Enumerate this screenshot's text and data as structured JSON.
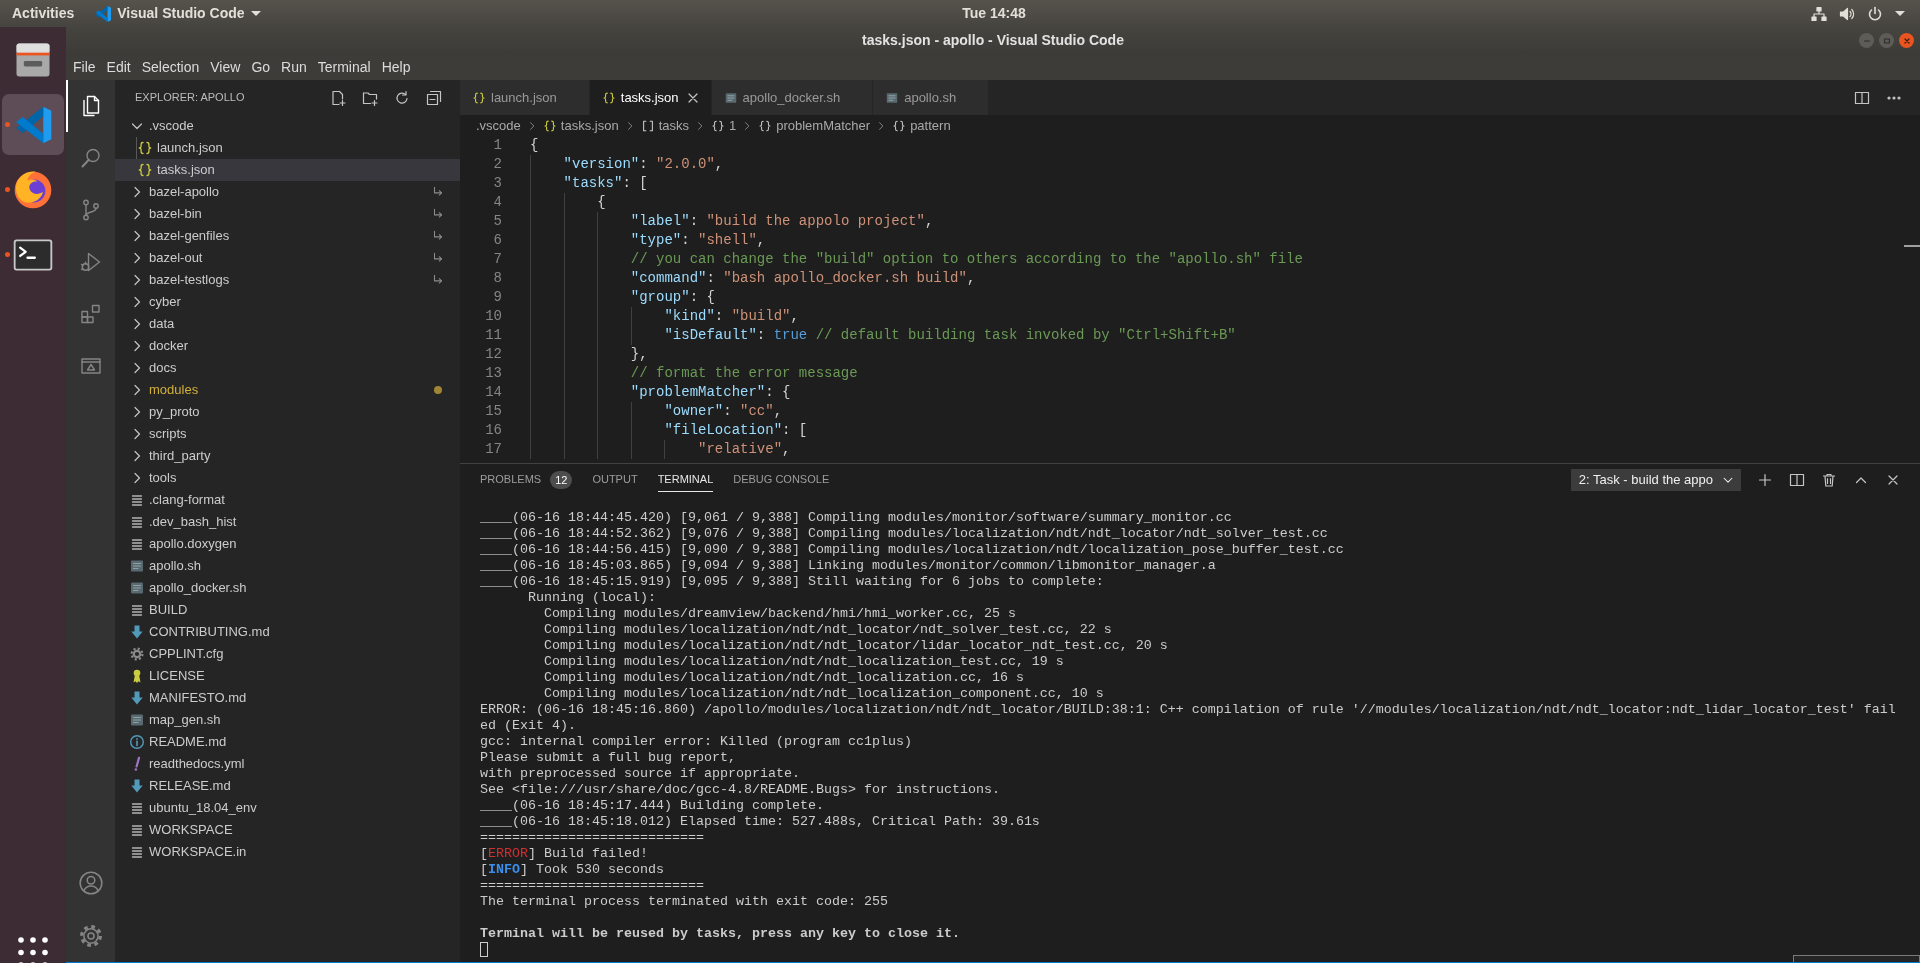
{
  "top_bar": {
    "activities": "Activities",
    "app_menu": "Visual Studio Code",
    "clock": "Tue 14:48"
  },
  "dock": {
    "apps": [
      {
        "kind": "files",
        "running": false,
        "selected": false
      },
      {
        "kind": "vscode",
        "running": true,
        "selected": true
      },
      {
        "kind": "firefox",
        "running": true,
        "selected": false
      },
      {
        "kind": "terminal",
        "running": true,
        "selected": false
      }
    ]
  },
  "window": {
    "title": "tasks.json - apollo - Visual Studio Code",
    "menu": [
      "File",
      "Edit",
      "Selection",
      "View",
      "Go",
      "Run",
      "Terminal",
      "Help"
    ]
  },
  "activity_bar": {
    "items": [
      {
        "kind": "explorer",
        "selected": true
      },
      {
        "kind": "search",
        "selected": false
      },
      {
        "kind": "scm",
        "selected": false
      },
      {
        "kind": "debug",
        "selected": false
      },
      {
        "kind": "extensions",
        "selected": false
      },
      {
        "kind": "remote",
        "selected": false
      }
    ],
    "bottom": [
      {
        "kind": "account"
      },
      {
        "kind": "settings"
      }
    ]
  },
  "sidebar": {
    "title": "EXPLORER: APOLLO",
    "tree": [
      {
        "label": ".vscode",
        "kind": "folder",
        "expanded": true,
        "selected": false,
        "symlink": false,
        "modified": false,
        "children": [
          {
            "label": "launch.json",
            "kind": "json",
            "selected": false,
            "symlink": false,
            "modified": false
          },
          {
            "label": "tasks.json",
            "kind": "json",
            "selected": true,
            "symlink": false,
            "modified": false
          }
        ]
      },
      {
        "label": "bazel-apollo",
        "kind": "folder",
        "expanded": false,
        "selected": false,
        "symlink": true,
        "modified": false
      },
      {
        "label": "bazel-bin",
        "kind": "folder",
        "expanded": false,
        "selected": false,
        "symlink": true,
        "modified": false
      },
      {
        "label": "bazel-genfiles",
        "kind": "folder",
        "expanded": false,
        "selected": false,
        "symlink": true,
        "modified": false
      },
      {
        "label": "bazel-out",
        "kind": "folder",
        "expanded": false,
        "selected": false,
        "symlink": true,
        "modified": false
      },
      {
        "label": "bazel-testlogs",
        "kind": "folder",
        "expanded": false,
        "selected": false,
        "symlink": true,
        "modified": false
      },
      {
        "label": "cyber",
        "kind": "folder",
        "expanded": false,
        "selected": false,
        "symlink": false,
        "modified": false
      },
      {
        "label": "data",
        "kind": "folder",
        "expanded": false,
        "selected": false,
        "symlink": false,
        "modified": false
      },
      {
        "label": "docker",
        "kind": "folder",
        "expanded": false,
        "selected": false,
        "symlink": false,
        "modified": false
      },
      {
        "label": "docs",
        "kind": "folder",
        "expanded": false,
        "selected": false,
        "symlink": false,
        "modified": false
      },
      {
        "label": "modules",
        "kind": "folder",
        "expanded": false,
        "selected": false,
        "symlink": false,
        "modified": true
      },
      {
        "label": "py_proto",
        "kind": "folder",
        "expanded": false,
        "selected": false,
        "symlink": false,
        "modified": false
      },
      {
        "label": "scripts",
        "kind": "folder",
        "expanded": false,
        "selected": false,
        "symlink": false,
        "modified": false
      },
      {
        "label": "third_party",
        "kind": "folder",
        "expanded": false,
        "selected": false,
        "symlink": false,
        "modified": false
      },
      {
        "label": "tools",
        "kind": "folder",
        "expanded": false,
        "selected": false,
        "symlink": false,
        "modified": false
      },
      {
        "label": ".clang-format",
        "kind": "text",
        "selected": false,
        "symlink": false,
        "modified": false
      },
      {
        "label": ".dev_bash_hist",
        "kind": "text",
        "selected": false,
        "symlink": false,
        "modified": false
      },
      {
        "label": "apollo.doxygen",
        "kind": "text",
        "selected": false,
        "symlink": false,
        "modified": false
      },
      {
        "label": "apollo.sh",
        "kind": "shell",
        "selected": false,
        "symlink": false,
        "modified": false
      },
      {
        "label": "apollo_docker.sh",
        "kind": "shell",
        "selected": false,
        "symlink": false,
        "modified": false
      },
      {
        "label": "BUILD",
        "kind": "text",
        "selected": false,
        "symlink": false,
        "modified": false
      },
      {
        "label": "CONTRIBUTING.md",
        "kind": "markdown",
        "selected": false,
        "symlink": false,
        "modified": false
      },
      {
        "label": "CPPLINT.cfg",
        "kind": "config",
        "selected": false,
        "symlink": false,
        "modified": false
      },
      {
        "label": "LICENSE",
        "kind": "license",
        "selected": false,
        "symlink": false,
        "modified": false
      },
      {
        "label": "MANIFESTO.md",
        "kind": "markdown",
        "selected": false,
        "symlink": false,
        "modified": false
      },
      {
        "label": "map_gen.sh",
        "kind": "shell",
        "selected": false,
        "symlink": false,
        "modified": false
      },
      {
        "label": "README.md",
        "kind": "info",
        "selected": false,
        "symlink": false,
        "modified": false
      },
      {
        "label": "readthedocs.yml",
        "kind": "yaml",
        "selected": false,
        "symlink": false,
        "modified": false
      },
      {
        "label": "RELEASE.md",
        "kind": "markdown",
        "selected": false,
        "symlink": false,
        "modified": false
      },
      {
        "label": "ubuntu_18.04_env",
        "kind": "text",
        "selected": false,
        "symlink": false,
        "modified": false
      },
      {
        "label": "WORKSPACE",
        "kind": "text",
        "selected": false,
        "symlink": false,
        "modified": false
      },
      {
        "label": "WORKSPACE.in",
        "kind": "text",
        "selected": false,
        "symlink": false,
        "modified": false
      }
    ]
  },
  "tabs": [
    {
      "label": "launch.json",
      "kind": "json",
      "selected": false
    },
    {
      "label": "tasks.json",
      "kind": "json",
      "selected": true
    },
    {
      "label": "apollo_docker.sh",
      "kind": "shell",
      "selected": false
    },
    {
      "label": "apollo.sh",
      "kind": "shell",
      "selected": false
    }
  ],
  "breadcrumbs": [
    {
      "label": ".vscode",
      "kind": "folder"
    },
    {
      "label": "tasks.json",
      "kind": "json"
    },
    {
      "label": "tasks",
      "kind": "array"
    },
    {
      "label": "1",
      "kind": "object"
    },
    {
      "label": "problemMatcher",
      "kind": "object"
    },
    {
      "label": "pattern",
      "kind": "object"
    }
  ],
  "editor": {
    "lines": [
      {
        "number": "1",
        "tokens": [
          {
            "kind": "punct",
            "text": "{"
          }
        ]
      },
      {
        "number": "2",
        "tokens": [
          {
            "kind": "key",
            "text": "    \"version\""
          },
          {
            "kind": "punct",
            "text": ": "
          },
          {
            "kind": "string",
            "text": "\"2.0.0\""
          },
          {
            "kind": "punct",
            "text": ","
          }
        ]
      },
      {
        "number": "3",
        "tokens": [
          {
            "kind": "key",
            "text": "    \"tasks\""
          },
          {
            "kind": "punct",
            "text": ": ["
          }
        ]
      },
      {
        "number": "4",
        "tokens": [
          {
            "kind": "punct",
            "text": "        {"
          }
        ]
      },
      {
        "number": "5",
        "tokens": [
          {
            "kind": "key",
            "text": "            \"label\""
          },
          {
            "kind": "punct",
            "text": ": "
          },
          {
            "kind": "string",
            "text": "\"build the appolo project\""
          },
          {
            "kind": "punct",
            "text": ","
          }
        ]
      },
      {
        "number": "6",
        "tokens": [
          {
            "kind": "key",
            "text": "            \"type\""
          },
          {
            "kind": "punct",
            "text": ": "
          },
          {
            "kind": "string",
            "text": "\"shell\""
          },
          {
            "kind": "punct",
            "text": ","
          }
        ]
      },
      {
        "number": "7",
        "tokens": [
          {
            "kind": "comment",
            "text": "            // you can change the \"build\" option to others according to the \"apollo.sh\" file"
          }
        ]
      },
      {
        "number": "8",
        "tokens": [
          {
            "kind": "key",
            "text": "            \"command\""
          },
          {
            "kind": "punct",
            "text": ": "
          },
          {
            "kind": "string",
            "text": "\"bash apollo_docker.sh build\""
          },
          {
            "kind": "punct",
            "text": ","
          }
        ]
      },
      {
        "number": "9",
        "tokens": [
          {
            "kind": "key",
            "text": "            \"group\""
          },
          {
            "kind": "punct",
            "text": ": {"
          }
        ]
      },
      {
        "number": "10",
        "tokens": [
          {
            "kind": "key",
            "text": "                \"kind\""
          },
          {
            "kind": "punct",
            "text": ": "
          },
          {
            "kind": "string",
            "text": "\"build\""
          },
          {
            "kind": "punct",
            "text": ","
          }
        ]
      },
      {
        "number": "11",
        "tokens": [
          {
            "kind": "key",
            "text": "                \"isDefault\""
          },
          {
            "kind": "punct",
            "text": ": "
          },
          {
            "kind": "keyword",
            "text": "true"
          },
          {
            "kind": "comment",
            "text": " // default building task invoked by \"Ctrl+Shift+B\""
          }
        ]
      },
      {
        "number": "12",
        "tokens": [
          {
            "kind": "punct",
            "text": "            },"
          }
        ]
      },
      {
        "number": "13",
        "tokens": [
          {
            "kind": "comment",
            "text": "            // format the error message"
          }
        ]
      },
      {
        "number": "14",
        "tokens": [
          {
            "kind": "key",
            "text": "            \"problemMatcher\""
          },
          {
            "kind": "punct",
            "text": ": {"
          }
        ]
      },
      {
        "number": "15",
        "tokens": [
          {
            "kind": "key",
            "text": "                \"owner\""
          },
          {
            "kind": "punct",
            "text": ": "
          },
          {
            "kind": "string",
            "text": "\"cc\""
          },
          {
            "kind": "punct",
            "text": ","
          }
        ]
      },
      {
        "number": "16",
        "tokens": [
          {
            "kind": "key",
            "text": "                \"fileLocation\""
          },
          {
            "kind": "punct",
            "text": ": ["
          }
        ]
      },
      {
        "number": "17",
        "tokens": [
          {
            "kind": "string",
            "text": "                    \"relative\""
          },
          {
            "kind": "punct",
            "text": ","
          }
        ]
      }
    ]
  },
  "panel": {
    "tabs": [
      {
        "label": "PROBLEMS",
        "badge": "12",
        "selected": false
      },
      {
        "label": "OUTPUT",
        "selected": false
      },
      {
        "label": "TERMINAL",
        "selected": true
      },
      {
        "label": "DEBUG CONSOLE",
        "selected": false
      }
    ],
    "terminal_picker": "2: Task - build the appo",
    "terminal": [
      {
        "kind": "text",
        "text": "____(06-16 18:44:45.420) [9,061 / 9,388] Compiling modules/monitor/software/summary_monitor.cc"
      },
      {
        "kind": "text",
        "text": "____(06-16 18:44:52.362) [9,076 / 9,388] Compiling modules/localization/ndt/ndt_locator/ndt_solver_test.cc"
      },
      {
        "kind": "text",
        "text": "____(06-16 18:44:56.415) [9,090 / 9,388] Compiling modules/localization/ndt/localization_pose_buffer_test.cc"
      },
      {
        "kind": "text",
        "text": "____(06-16 18:45:03.865) [9,094 / 9,388] Linking modules/monitor/common/libmonitor_manager.a"
      },
      {
        "kind": "text",
        "text": "____(06-16 18:45:15.919) [9,095 / 9,388] Still waiting for 6 jobs to complete:"
      },
      {
        "kind": "text",
        "text": "      Running (local):"
      },
      {
        "kind": "text",
        "text": "        Compiling modules/dreamview/backend/hmi/hmi_worker.cc, 25 s"
      },
      {
        "kind": "text",
        "text": "        Compiling modules/localization/ndt/ndt_locator/ndt_solver_test.cc, 22 s"
      },
      {
        "kind": "text",
        "text": "        Compiling modules/localization/ndt/ndt_locator/lidar_locator_ndt_test.cc, 20 s"
      },
      {
        "kind": "text",
        "text": "        Compiling modules/localization/ndt/ndt_localization_test.cc, 19 s"
      },
      {
        "kind": "text",
        "text": "        Compiling modules/localization/ndt/ndt_localization.cc, 16 s"
      },
      {
        "kind": "text",
        "text": "        Compiling modules/localization/ndt/ndt_localization_component.cc, 10 s"
      },
      {
        "kind": "text",
        "text": "ERROR: (06-16 18:45:16.860) /apollo/modules/localization/ndt/ndt_locator/BUILD:38:1: C++ compilation of rule '//modules/localization/ndt/ndt_locator:ndt_lidar_locator_test' fail"
      },
      {
        "kind": "text",
        "text": "ed (Exit 4)."
      },
      {
        "kind": "text",
        "text": "gcc: internal compiler error: Killed (program cc1plus)"
      },
      {
        "kind": "text",
        "text": "Please submit a full bug report,"
      },
      {
        "kind": "text",
        "text": "with preprocessed source if appropriate."
      },
      {
        "kind": "text",
        "text": "See <file:///usr/share/doc/gcc-4.8/README.Bugs> for instructions."
      },
      {
        "kind": "text",
        "text": "____(06-16 18:45:17.444) Building complete."
      },
      {
        "kind": "text",
        "text": "____(06-16 18:45:18.012) Elapsed time: 527.488s, Critical Path: 39.61s"
      },
      {
        "kind": "text",
        "text": "============================"
      },
      {
        "kind": "tagged",
        "parts": [
          "[",
          "ERROR",
          "] Build failed!"
        ],
        "color": "#cd3131",
        "bold": false
      },
      {
        "kind": "tagged",
        "parts": [
          "[",
          "INFO",
          "] Took 530 seconds"
        ],
        "color": "#3b8eea",
        "bold": true
      },
      {
        "kind": "text",
        "text": "============================"
      },
      {
        "kind": "text",
        "text": "The terminal process terminated with exit code: 255"
      },
      {
        "kind": "blank"
      },
      {
        "kind": "bold",
        "text": "Terminal will be reused by tasks, press any key to close it."
      },
      {
        "kind": "cursor"
      }
    ]
  }
}
